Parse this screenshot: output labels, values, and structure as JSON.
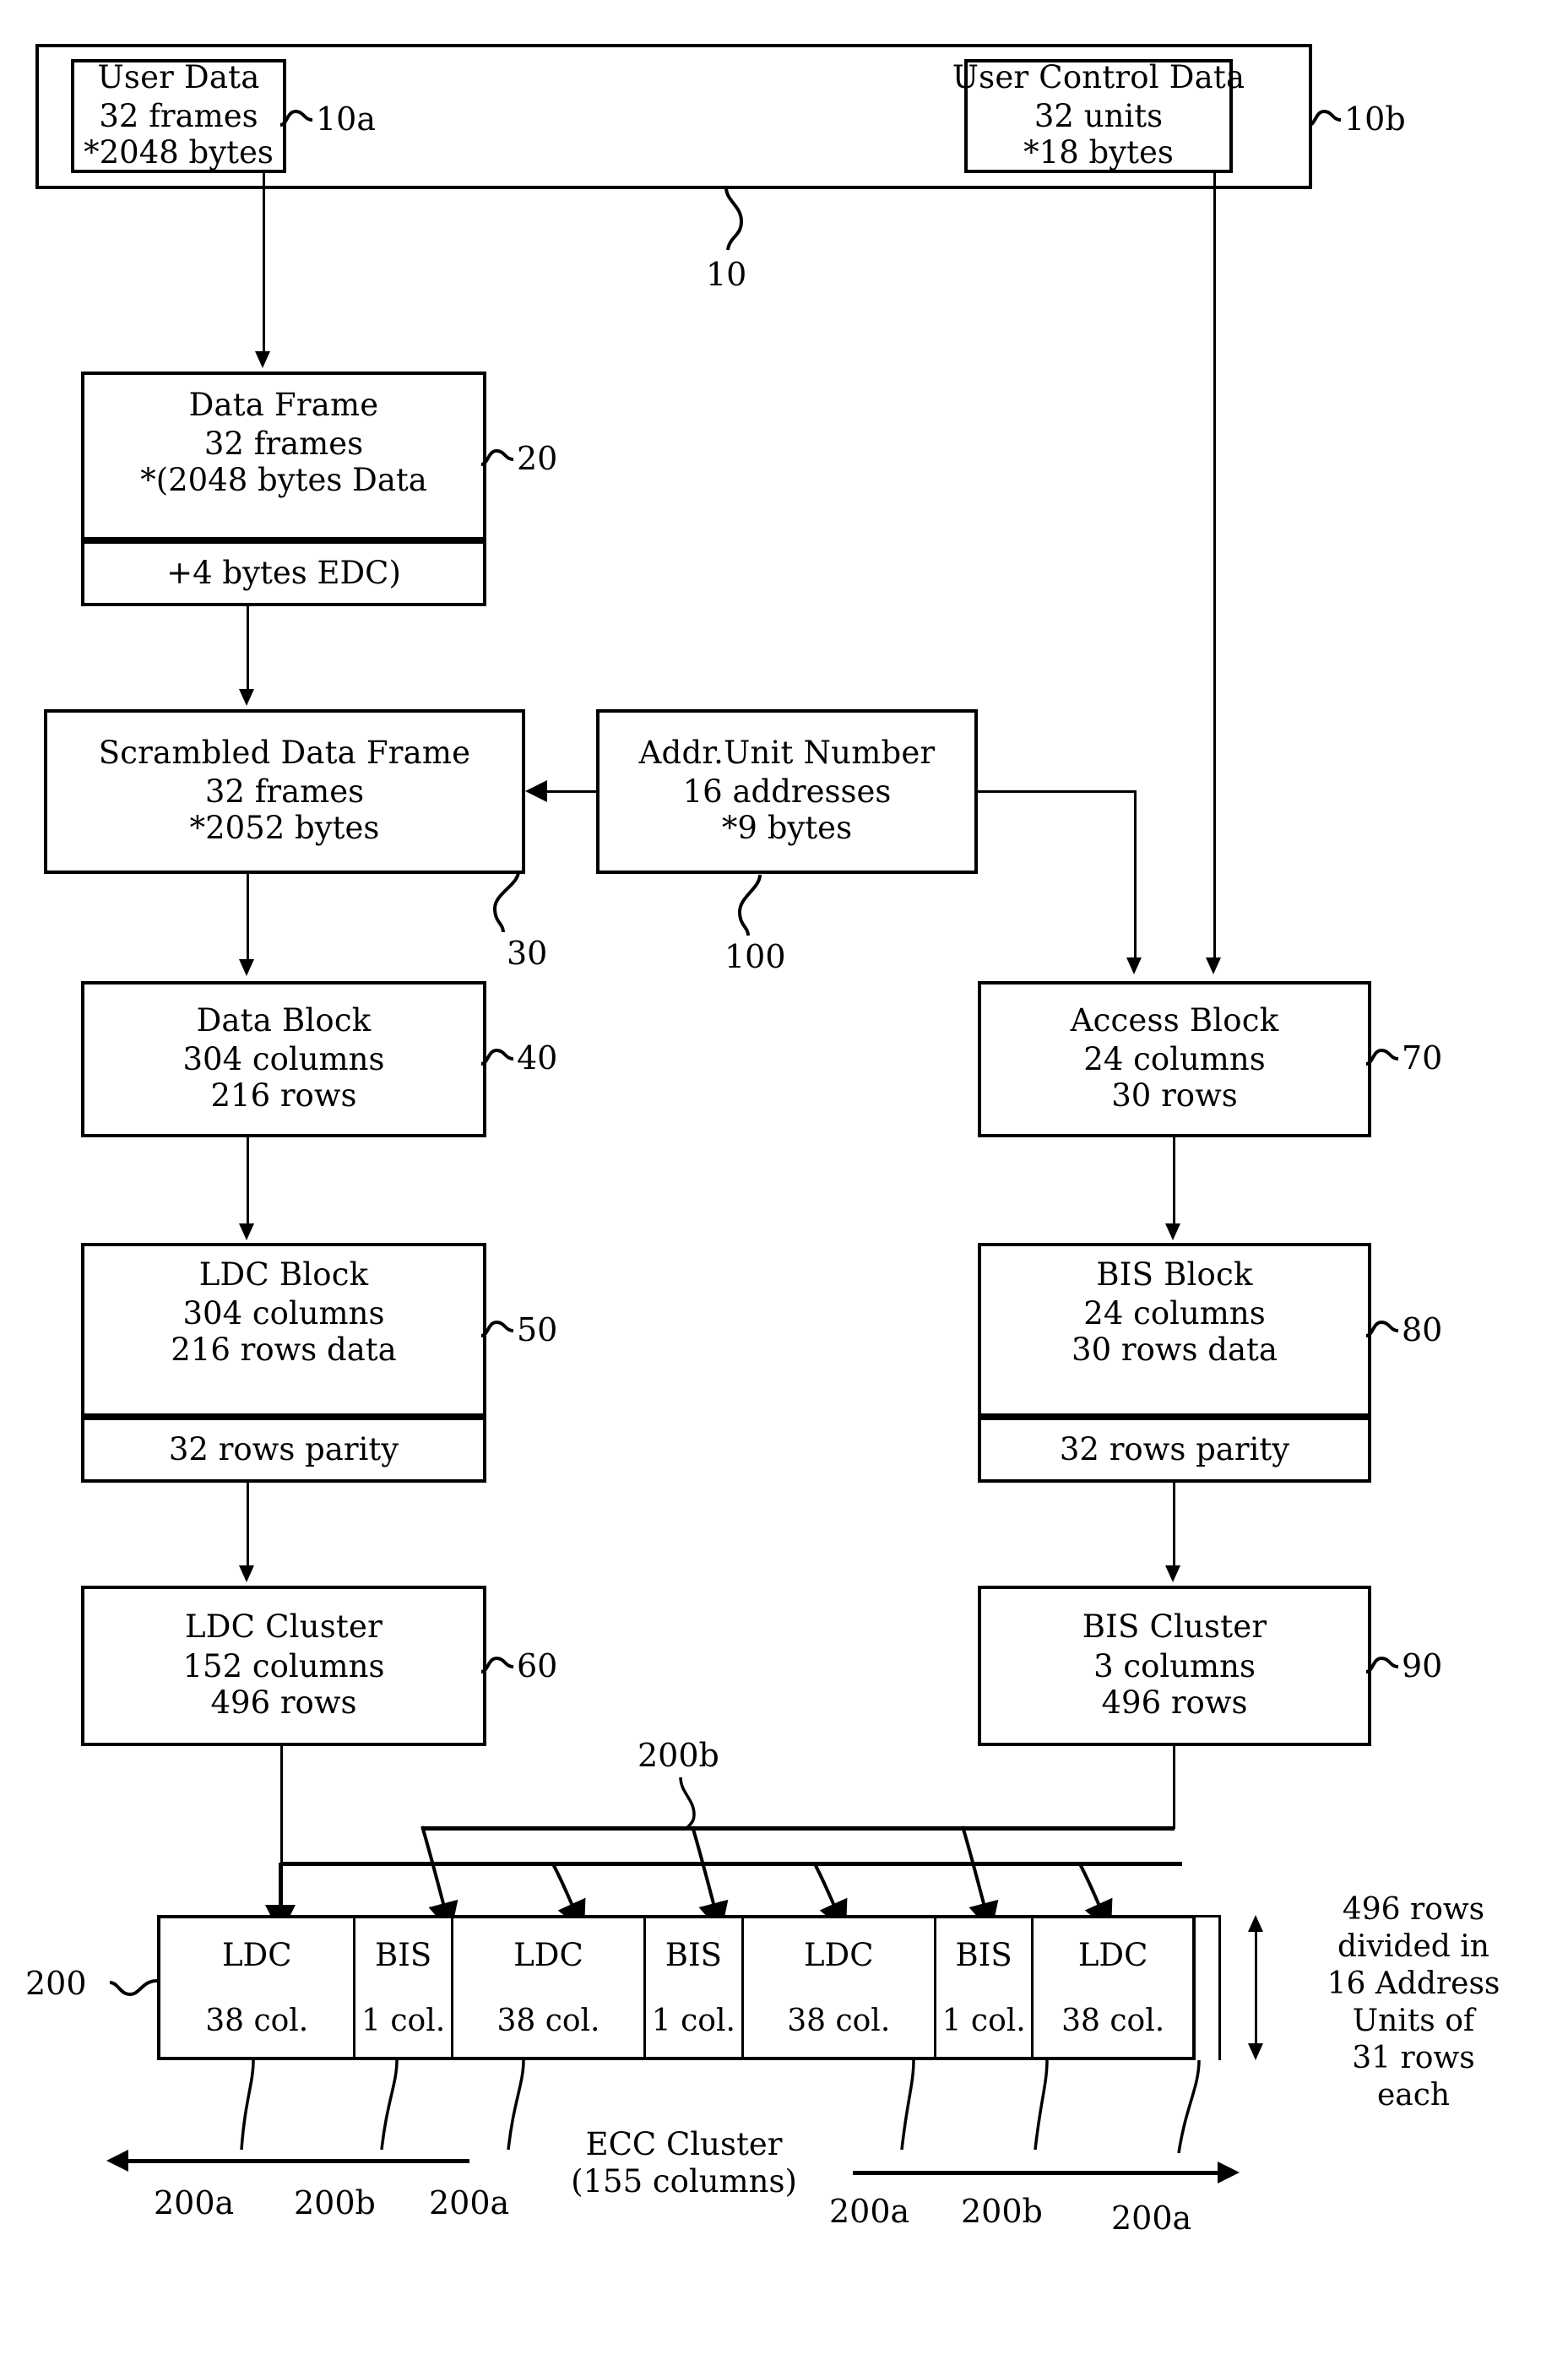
{
  "figure": {
    "type": "patent-block-diagram",
    "title": "Data format conversion flow"
  },
  "blocks": {
    "user_data": {
      "title": "User Data",
      "lines": [
        "32 frames",
        "*2048 bytes"
      ],
      "ref": "10a"
    },
    "user_control_data": {
      "title": "User Control Data",
      "lines": [
        "32 units",
        "*18 bytes"
      ],
      "ref": "10b"
    },
    "group_outer": {
      "ref": "10"
    },
    "data_frame": {
      "title": "Data Frame",
      "lines": [
        "32 frames",
        "*(2048 bytes Data"
      ],
      "sub": "+4 bytes EDC)",
      "ref": "20"
    },
    "scrambled_data_frame": {
      "title": "Scrambled Data Frame",
      "lines": [
        "32 frames",
        "*2052 bytes"
      ],
      "ref": "30"
    },
    "addr_unit_number": {
      "title": "Addr.Unit Number",
      "lines": [
        "16 addresses",
        "*9 bytes"
      ],
      "ref": "100"
    },
    "data_block": {
      "title": "Data Block",
      "lines": [
        "304 columns",
        "216 rows"
      ],
      "ref": "40"
    },
    "ldc_block": {
      "title": "LDC Block",
      "lines": [
        "304 columns",
        "216 rows data"
      ],
      "sub": "32 rows parity",
      "ref": "50"
    },
    "ldc_cluster": {
      "title": "LDC Cluster",
      "lines": [
        "152 columns",
        "496 rows"
      ],
      "ref": "60"
    },
    "access_block": {
      "title": "Access Block",
      "lines": [
        "24 columns",
        "30 rows"
      ],
      "ref": "70"
    },
    "bis_block": {
      "title": "BIS Block",
      "lines": [
        "24 columns",
        "30 rows data"
      ],
      "sub": "32 rows parity",
      "ref": "80"
    },
    "bis_cluster": {
      "title": "BIS Cluster",
      "lines": [
        "3 columns",
        "496 rows"
      ],
      "ref": "90"
    }
  },
  "ecc_cluster": {
    "ref": "200",
    "ref_top": "200b",
    "caption_line1": "ECC Cluster",
    "caption_line2": "(155 columns)",
    "cells": [
      {
        "label": "LDC",
        "size": "38 col.",
        "ref": "200a"
      },
      {
        "label": "BIS",
        "size": "1 col.",
        "ref": "200b"
      },
      {
        "label": "LDC",
        "size": "38 col.",
        "ref": "200a"
      },
      {
        "label": "BIS",
        "size": "1 col.",
        "ref": "200b"
      },
      {
        "label": "LDC",
        "size": "38 col.",
        "ref": "200a"
      },
      {
        "label": "BIS",
        "size": "1 col.",
        "ref": "200b"
      },
      {
        "label": "LDC",
        "size": "38 col.",
        "ref": "200a"
      }
    ],
    "bottom_refs_left": [
      "200a",
      "200b",
      "200a"
    ],
    "bottom_refs_right": [
      "200a",
      "200b",
      "200a"
    ],
    "rows_note": [
      "496 rows",
      "divided in",
      "16 Address",
      "Units of",
      "31 rows",
      "each"
    ]
  }
}
